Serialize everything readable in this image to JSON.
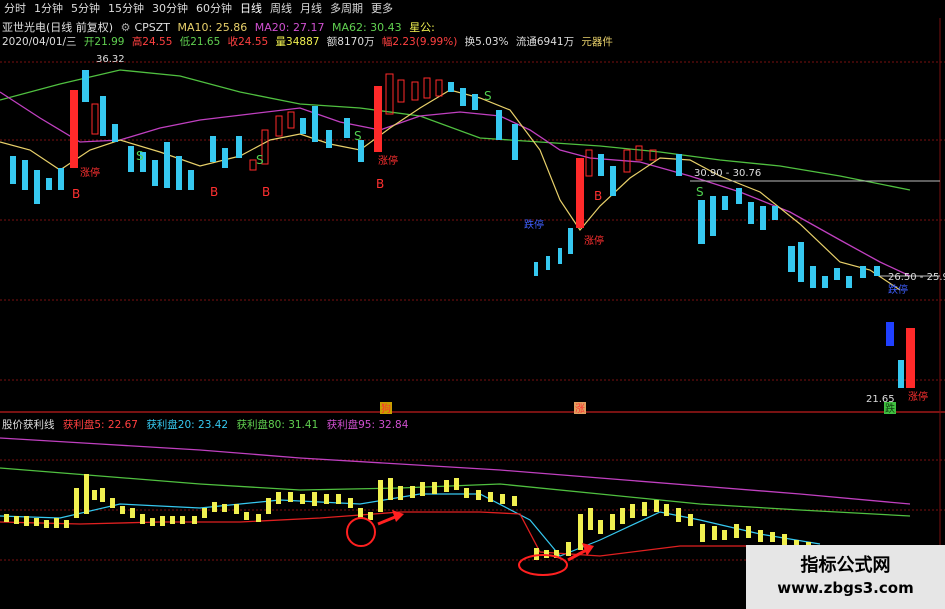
{
  "tabs": [
    "分时",
    "1分钟",
    "5分钟",
    "15分钟",
    "30分钟",
    "60分钟",
    "日线",
    "周线",
    "月线",
    "多周期",
    "更多"
  ],
  "active_tab": 6,
  "header": {
    "stock": "亚世光电(日线 前复权)",
    "indicator": "CPSZT",
    "ma10": "MA10: 25.86",
    "ma20": "MA20: 27.17",
    "ma62": "MA62: 30.43",
    "flag": "星公:"
  },
  "quote": {
    "date": "2020/04/01/三",
    "open": "开21.99",
    "high": "高24.55",
    "low": "低21.65",
    "close": "收24.55",
    "volume": "量34887",
    "amount": "额8170万",
    "change": "幅2.23(9.99%)",
    "turnover": "换5.03%",
    "float": "流通6941万",
    "unit": "元器件"
  },
  "labels": {
    "high_price": "36.32",
    "low_price": "21.65",
    "range_label": "30.90 - 30.76",
    "right_price": "26.50 - 25.9",
    "limit_up": "涨停",
    "limit_down": "跌停",
    "b": "B",
    "s": "S",
    "rise": "涨",
    "fall": "跌",
    "left_mark": "狗",
    "low_marker": "跌停"
  },
  "sub": {
    "name": "股价获利线",
    "l1": "获利盘5: 22.67",
    "l2": "获利盘20: 23.42",
    "l3": "获利盘80: 31.41",
    "l4": "获利盘95: 32.84"
  },
  "watermark": {
    "line1": "指标公式网",
    "line2": "www.zbgs3.com"
  },
  "colors": {
    "up": "#ff2a2a",
    "down": "#36c8f0",
    "ma10": "#e8d06a",
    "ma20": "#c040c0",
    "ma62": "#50c040",
    "chip": "#f0f050",
    "grid": "#7a1010"
  }
}
